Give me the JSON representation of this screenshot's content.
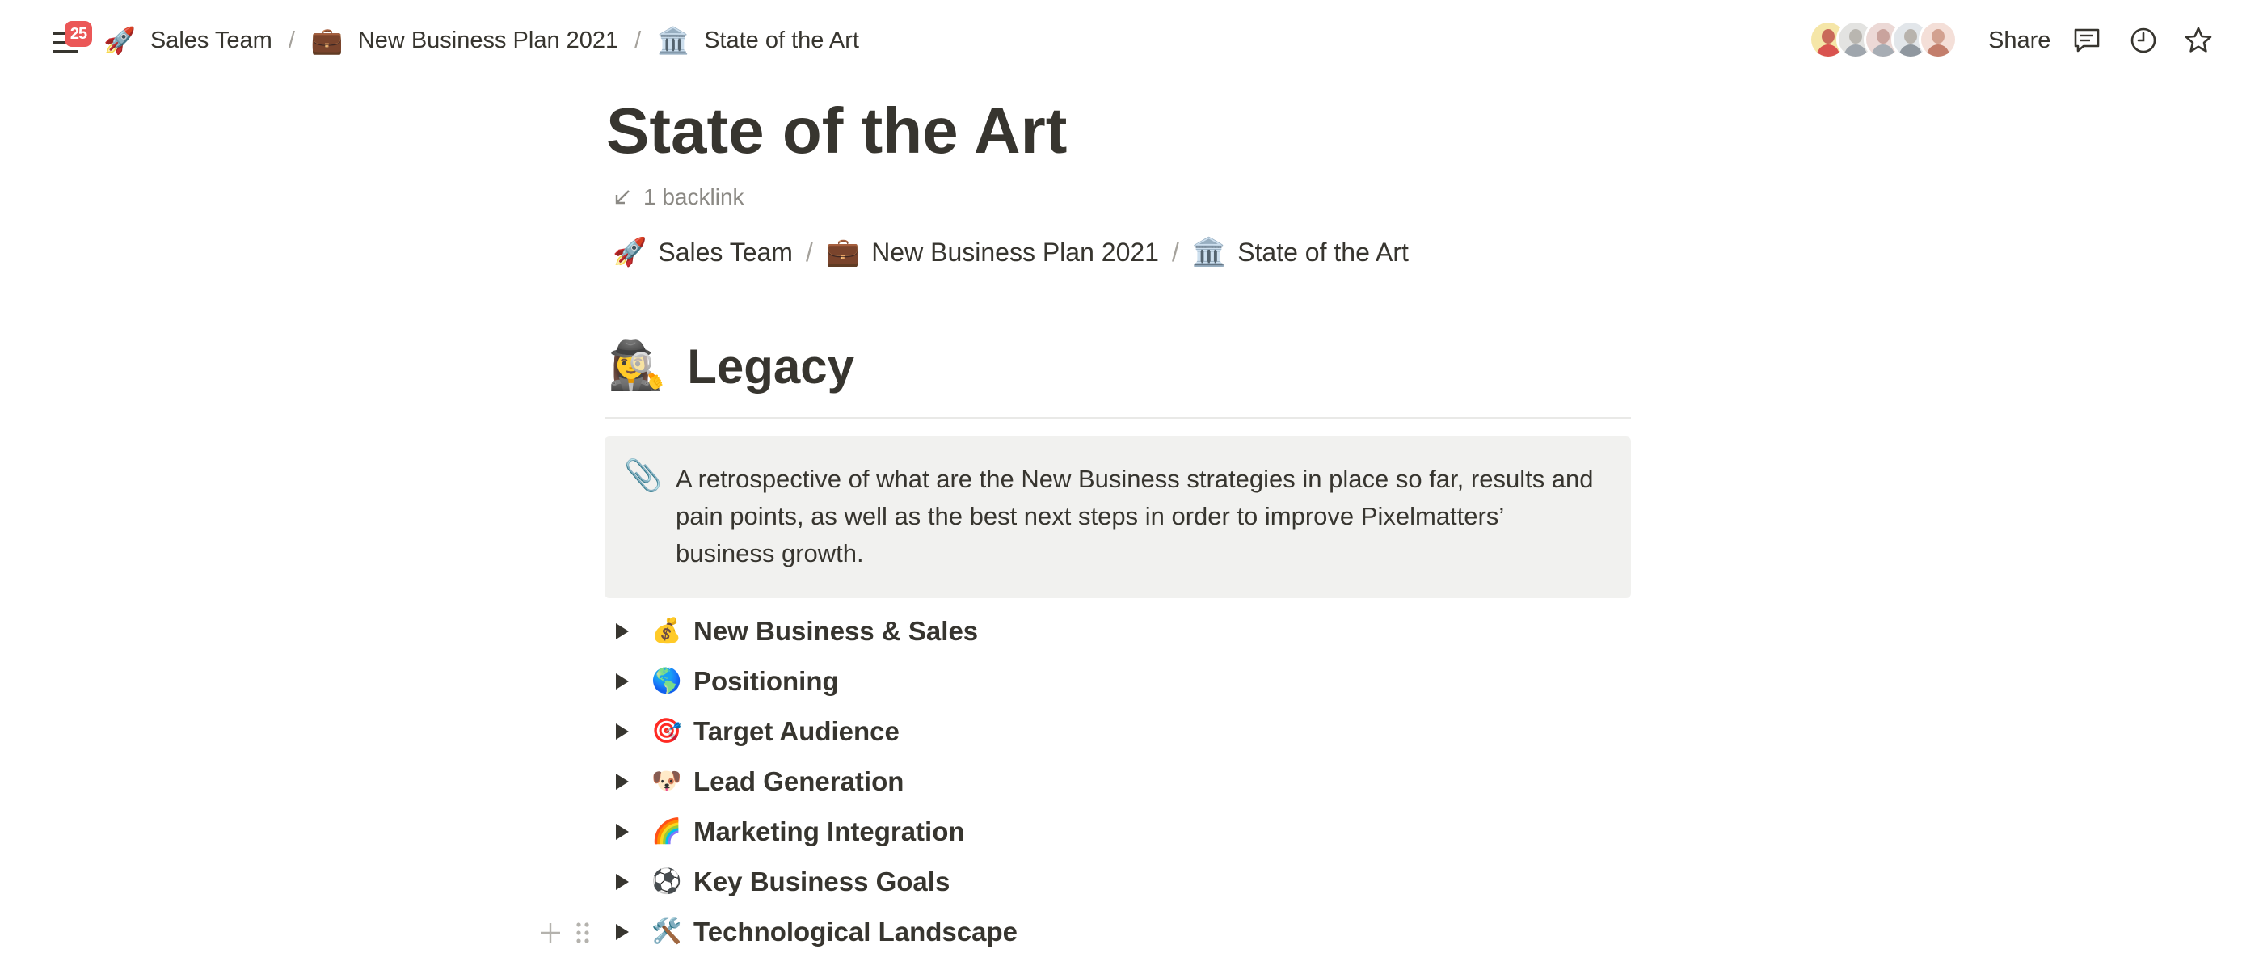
{
  "topbar": {
    "notification_count": "25",
    "breadcrumbs": [
      {
        "emoji": "🚀",
        "label": "Sales Team"
      },
      {
        "emoji": "💼",
        "label": "New Business Plan 2021"
      },
      {
        "emoji": "🏛️",
        "label": "State of the Art"
      }
    ],
    "separator": "/",
    "share_label": "Share",
    "icons": [
      "menu-icon",
      "comments-icon",
      "history-icon",
      "star-icon"
    ]
  },
  "page": {
    "title": "State of the Art",
    "backlink_label": "1 backlink",
    "inline_breadcrumbs": [
      {
        "emoji": "🚀",
        "label": "Sales Team"
      },
      {
        "emoji": "💼",
        "label": "New Business Plan 2021"
      },
      {
        "emoji": "🏛️",
        "label": "State of the Art"
      }
    ],
    "heading": {
      "emoji": "🕵️‍♀️",
      "label": "Legacy"
    },
    "callout": {
      "emoji": "📎",
      "text": "A retrospective of what are the New Business strategies in place so far, results and pain points, as well as the best next steps in order to improve Pixelmatters’ business growth."
    },
    "toggles": [
      {
        "emoji": "💰",
        "label": "New Business & Sales"
      },
      {
        "emoji": "🌎",
        "label": "Positioning"
      },
      {
        "emoji": "🎯",
        "label": "Target Audience"
      },
      {
        "emoji": "🐶",
        "label": "Lead Generation"
      },
      {
        "emoji": "🌈",
        "label": "Marketing Integration"
      },
      {
        "emoji": "⚽",
        "label": "Key Business Goals"
      },
      {
        "emoji": "🛠️",
        "label": "Technological Landscape"
      }
    ]
  },
  "colors": {
    "text": "#37352f",
    "muted": "#8b8984",
    "callout_bg": "#f1f1ef",
    "badge": "#eb5757",
    "divider": "#e9e9e7"
  }
}
